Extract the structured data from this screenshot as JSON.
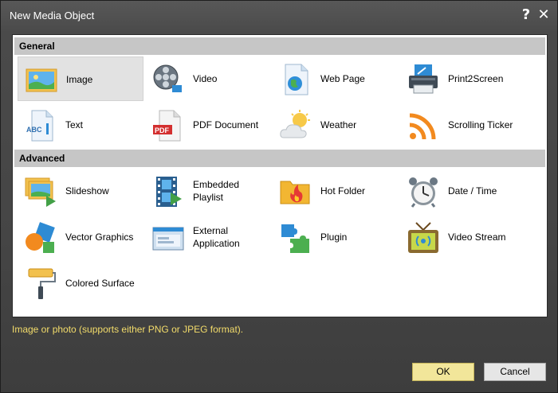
{
  "window": {
    "title": "New Media Object",
    "help_label": "?",
    "close_label": "✕"
  },
  "sections": {
    "general": "General",
    "advanced": "Advanced"
  },
  "items": {
    "image": "Image",
    "video": "Video",
    "web_page": "Web Page",
    "print2screen": "Print2Screen",
    "text": "Text",
    "pdf_document": "PDF Document",
    "weather": "Weather",
    "scrolling_ticker": "Scrolling Ticker",
    "slideshow": "Slideshow",
    "embedded_playlist": "Embedded Playlist",
    "hot_folder": "Hot Folder",
    "date_time": "Date / Time",
    "vector_graphics": "Vector Graphics",
    "external_application": "External Application",
    "plugin": "Plugin",
    "video_stream": "Video Stream",
    "colored_surface": "Colored Surface"
  },
  "icon_text": {
    "abc": "ABC",
    "pdf": "PDF"
  },
  "selected_item": "Image",
  "description": "Image or photo (supports either PNG or JPEG format).",
  "buttons": {
    "ok": "OK",
    "cancel": "Cancel"
  },
  "colors": {
    "accent": "#f2e69a",
    "description_text": "#f3dc6a",
    "section_header": "#c6c6c6"
  }
}
